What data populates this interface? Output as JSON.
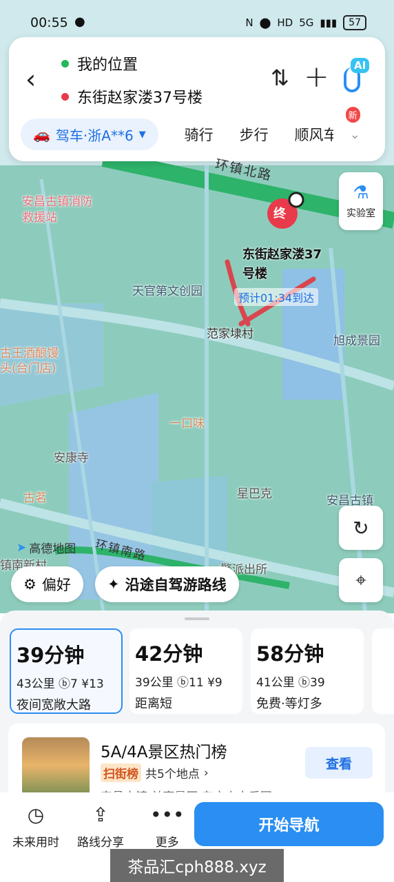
{
  "status_bar": {
    "time": "00:55",
    "battery": "57",
    "network": "5G",
    "hd": "HD"
  },
  "search": {
    "origin": "我的位置",
    "destination": "东街赵家溇37号楼",
    "mode_active": "驾车·浙A**6",
    "modes": [
      "骑行",
      "步行",
      "顺风车"
    ],
    "new_badge": "新",
    "ai_label": "AI"
  },
  "map": {
    "lab_label": "实验室",
    "end_marker": "终",
    "destination_label": "东街赵家溇37号楼",
    "eta_label": "预计01:34到达",
    "road_north": "环镇北路",
    "road_south": "环镇南路",
    "brand": "高德地图",
    "pois": [
      {
        "name": "安昌古镇消防救援站"
      },
      {
        "name": "天官第文创园"
      },
      {
        "name": "范家埭村"
      },
      {
        "name": "旭成景园"
      },
      {
        "name": "古王酒酿馒头(台门店)"
      },
      {
        "name": "一口味"
      },
      {
        "name": "安康寺"
      },
      {
        "name": "星巴克"
      },
      {
        "name": "古茗"
      },
      {
        "name": "安昌古镇"
      },
      {
        "name": "镇南新村"
      },
      {
        "name": "警派出所"
      },
      {
        "name": "绍木"
      },
      {
        "name": "村"
      }
    ],
    "chip_preference": "偏好",
    "chip_scenic": "沿途自驾游路线"
  },
  "routes": [
    {
      "time": "39分钟",
      "distance": "43公里",
      "lights": "7",
      "toll": "13",
      "note": "夜间宽敞大路",
      "selected": true
    },
    {
      "time": "42分钟",
      "distance": "39公里",
      "lights": "11",
      "toll": "9",
      "note": "距离短",
      "selected": false
    },
    {
      "time": "58分钟",
      "distance": "41公里",
      "lights": "39",
      "toll": "",
      "note": "免费·等灯多",
      "selected": false
    }
  ],
  "rank_card": {
    "title": "5A/4A景区热门榜",
    "tag": "扫街榜",
    "count": "共5个地点",
    "subtitle": "安昌古镇 兰亭景区 东方山水乐园",
    "button": "查看"
  },
  "bottom_bar": {
    "future": "未来用时",
    "share": "路线分享",
    "more": "更多",
    "start": "开始导航"
  },
  "watermark": "茶品汇cph888.xyz"
}
